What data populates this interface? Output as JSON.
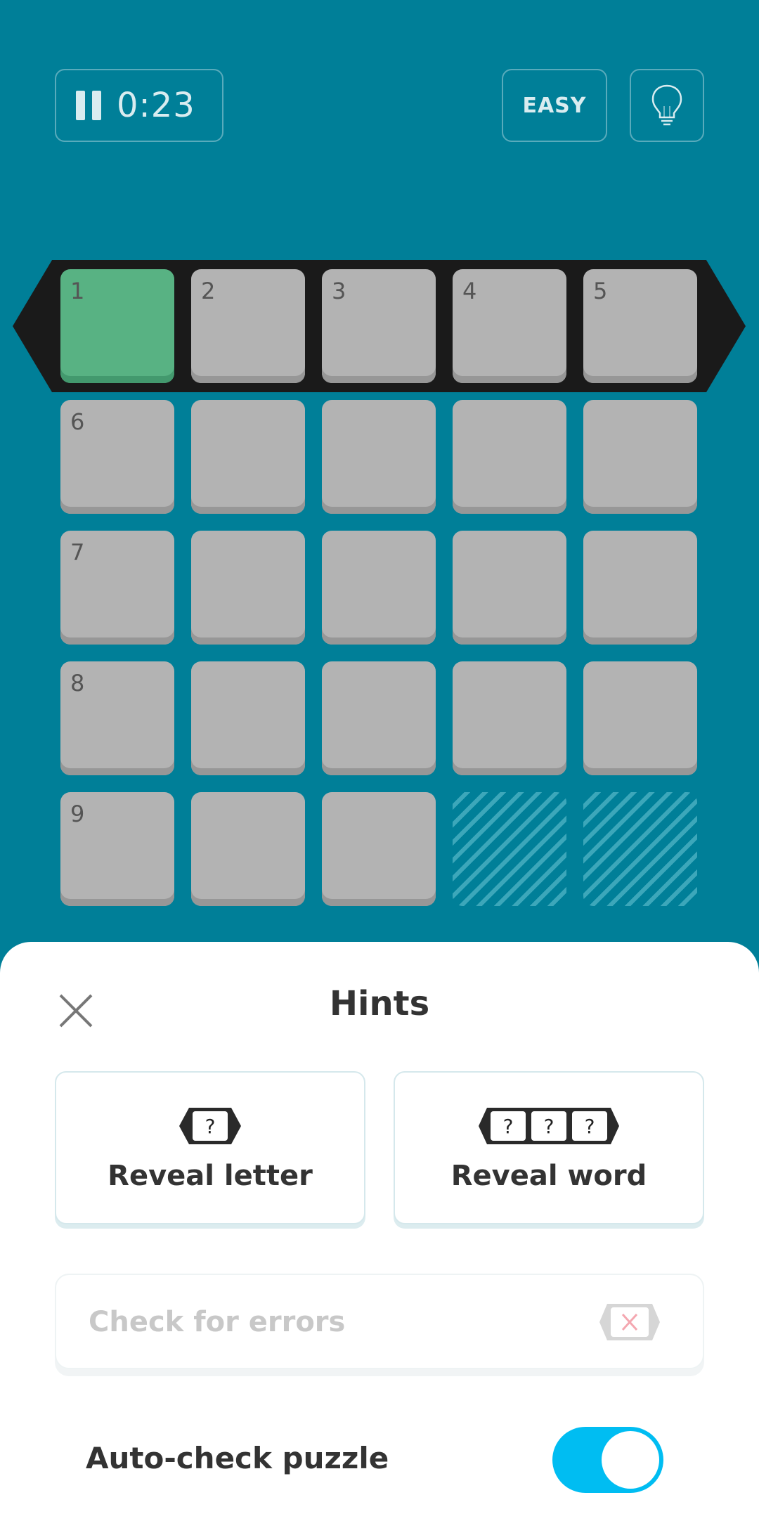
{
  "header": {
    "timer": "0:23",
    "difficulty": "EASY"
  },
  "grid": {
    "selected_cell": 1,
    "rows": [
      [
        {
          "num": "1",
          "state": "selected"
        },
        {
          "num": "2",
          "state": "empty"
        },
        {
          "num": "3",
          "state": "empty"
        },
        {
          "num": "4",
          "state": "empty"
        },
        {
          "num": "5",
          "state": "empty"
        }
      ],
      [
        {
          "num": "6",
          "state": "empty"
        },
        {
          "num": "",
          "state": "empty"
        },
        {
          "num": "",
          "state": "empty"
        },
        {
          "num": "",
          "state": "empty"
        },
        {
          "num": "",
          "state": "empty"
        }
      ],
      [
        {
          "num": "7",
          "state": "empty"
        },
        {
          "num": "",
          "state": "empty"
        },
        {
          "num": "",
          "state": "empty"
        },
        {
          "num": "",
          "state": "empty"
        },
        {
          "num": "",
          "state": "empty"
        }
      ],
      [
        {
          "num": "8",
          "state": "empty"
        },
        {
          "num": "",
          "state": "empty"
        },
        {
          "num": "",
          "state": "empty"
        },
        {
          "num": "",
          "state": "empty"
        },
        {
          "num": "",
          "state": "empty"
        }
      ],
      [
        {
          "num": "9",
          "state": "empty"
        },
        {
          "num": "",
          "state": "empty"
        },
        {
          "num": "",
          "state": "empty"
        },
        {
          "num": "",
          "state": "blocked"
        },
        {
          "num": "",
          "state": "blocked"
        }
      ]
    ]
  },
  "hints": {
    "title": "Hints",
    "reveal_letter": "Reveal letter",
    "reveal_word": "Reveal word",
    "icon_glyph": "?",
    "check_errors": "Check for errors",
    "auto_check": "Auto-check puzzle",
    "auto_check_enabled": true
  },
  "colors": {
    "background": "#007f98",
    "selected_cell": "#58b283",
    "toggle_on": "#00bdf2",
    "error_x": "#f4a7b0"
  }
}
